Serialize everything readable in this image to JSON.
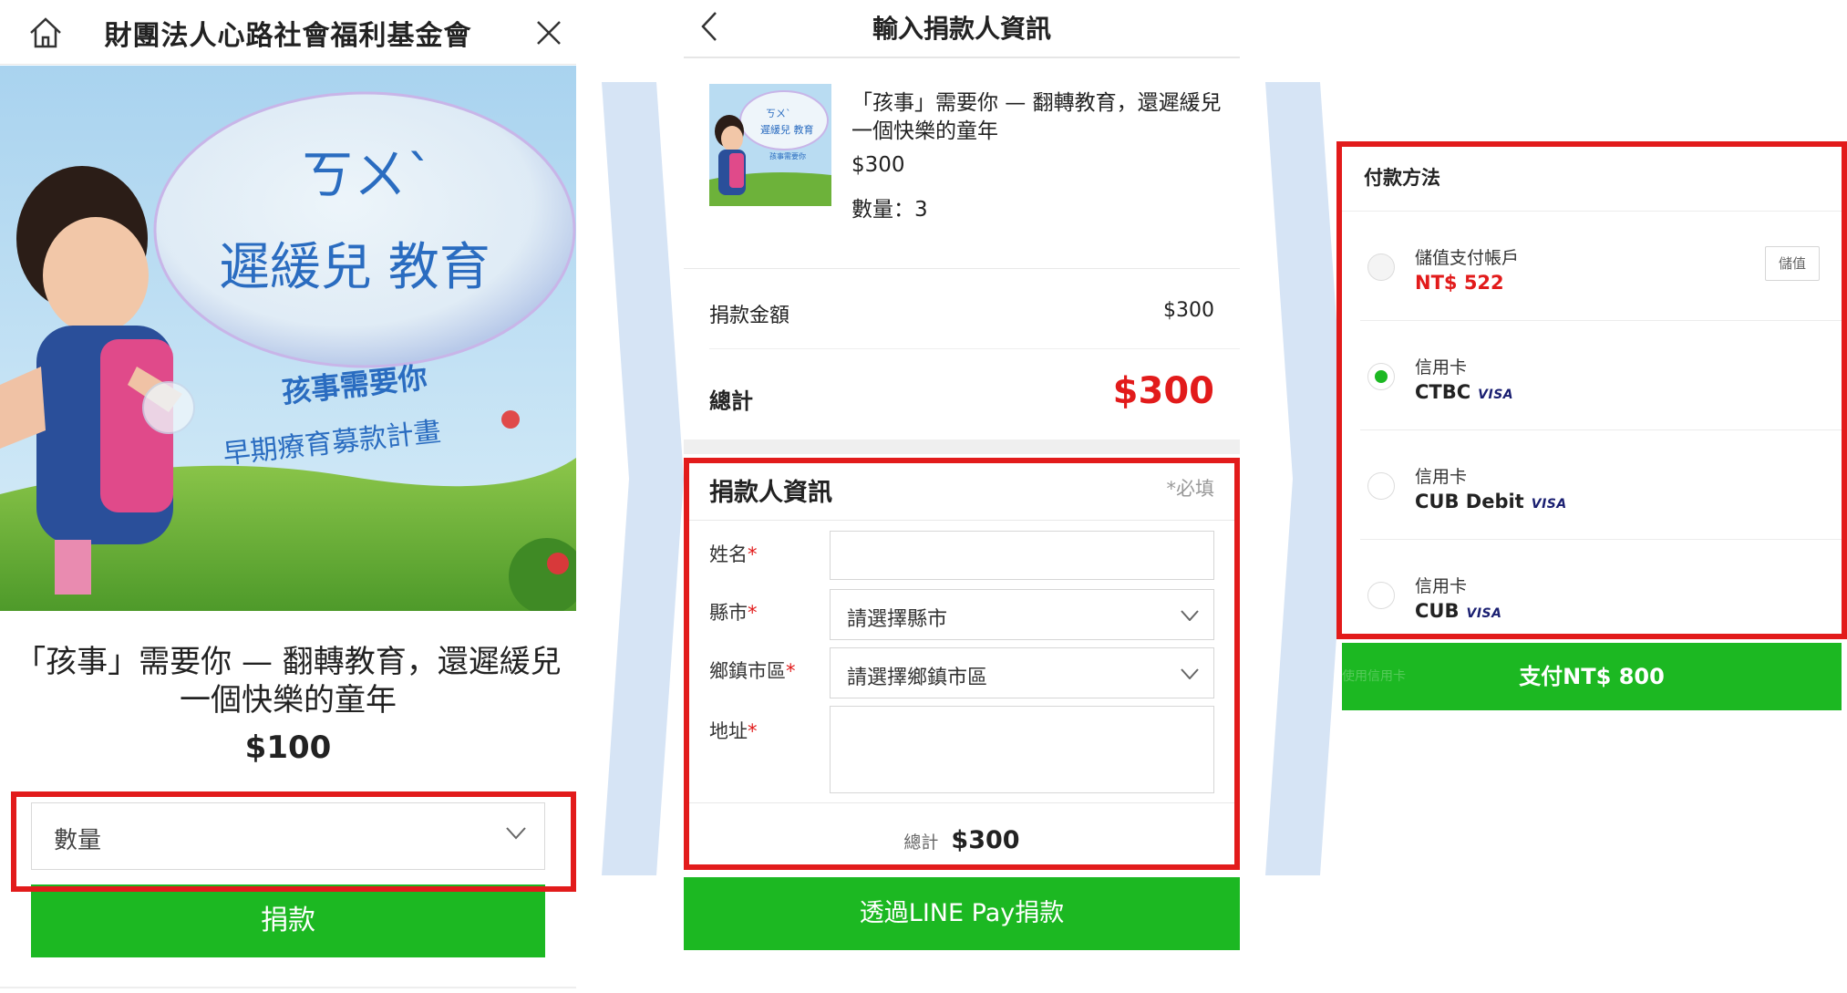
{
  "panel1": {
    "header_title": "財團法人心路社會福利基金會",
    "hero_text": {
      "bubble_line1": "ㄎㄨˋ",
      "bubble_line2": "遲緩兒 教育",
      "slogan1": "孩事需要你",
      "slogan2": "早期療育募款計畫"
    },
    "campaign_title": "「孩事」需要你 — 翻轉教育，還遲緩兒一個快樂的童年",
    "price": "$100",
    "quantity_placeholder": "數量",
    "donate_button": "捐款"
  },
  "panel2": {
    "title": "輸入捐款人資訊",
    "product_name": "「孩事」需要你 — 翻轉教育，還遲緩兒一個快樂的童年",
    "product_price": "$300",
    "product_qty": "數量：3",
    "amount_label": "捐款金額",
    "amount_value": "$300",
    "total_label": "總計",
    "total_value": "$300",
    "section_title": "捐款人資訊",
    "required_note": "*必填",
    "fields": {
      "name_label": "姓名",
      "city_label": "縣市",
      "city_placeholder": "請選擇縣市",
      "district_label": "鄉鎮市區",
      "district_placeholder": "請選擇鄉鎮市區",
      "address_label": "地址",
      "star": "*"
    },
    "footer_total_label": "總計",
    "footer_total_value": "$300",
    "pay_button": "透過LINE Pay捐款"
  },
  "panel3": {
    "heading": "付款方法",
    "methods": [
      {
        "type": "儲值支付帳戶",
        "detail": "NT$ 522",
        "selected": false,
        "action": "儲值"
      },
      {
        "type": "信用卡",
        "detail": "CTBC",
        "brand": "VISA",
        "selected": true
      },
      {
        "type": "信用卡",
        "detail": "CUB Debit",
        "brand": "VISA",
        "selected": false
      },
      {
        "type": "信用卡",
        "detail": "CUB",
        "brand": "VISA",
        "selected": false
      }
    ],
    "pay_button": "支付NT$ 800",
    "pay_button_ghost": "使用信用卡"
  },
  "colors": {
    "line_green": "#1cb822",
    "highlight_red": "#e21b1b",
    "chevron_blue": "#d6e4f5"
  }
}
